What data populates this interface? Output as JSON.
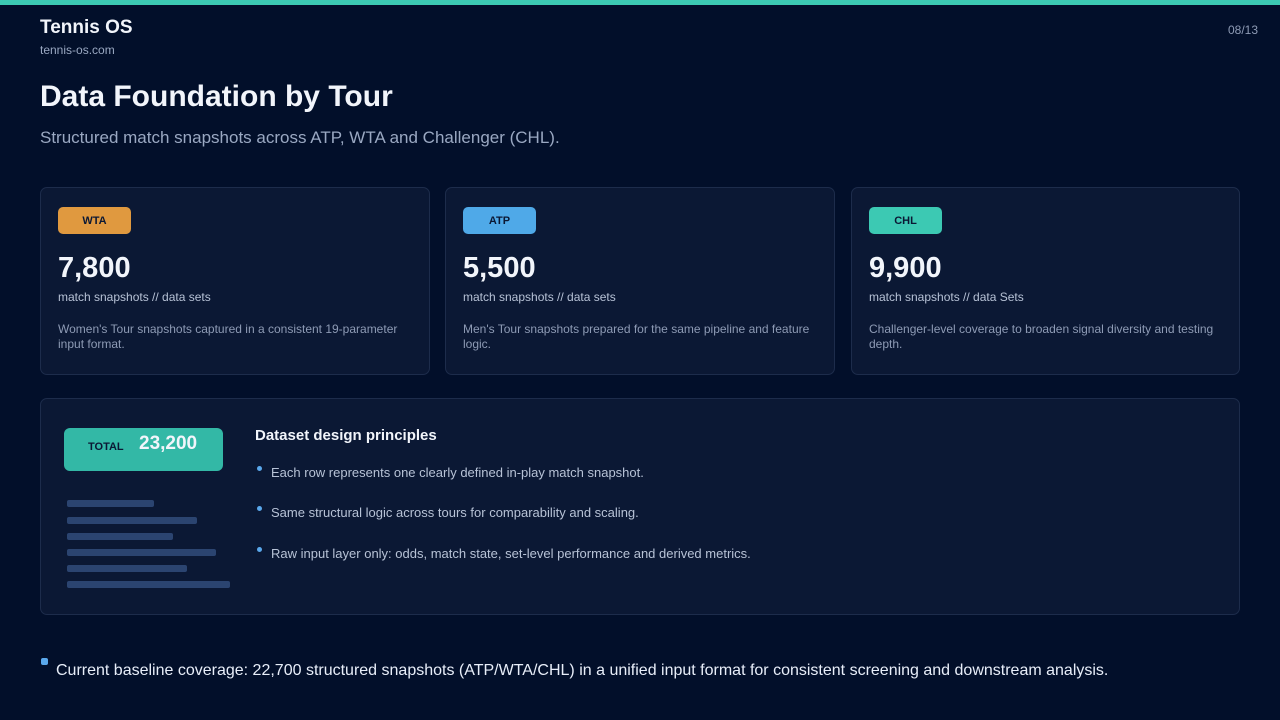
{
  "brand": {
    "name": "Tennis OS",
    "url": "tennis-os.com"
  },
  "page_number": "08/13",
  "title": "Data Foundation by Tour",
  "subtitle": "Structured match snapshots across ATP, WTA and Challenger (CHL).",
  "colors": {
    "accent": "#3cc9b3",
    "wta": "#e0993f",
    "atp": "#4fa9e8",
    "chl": "#3cc9b3",
    "background": "#020f2a",
    "card": "#0b1834"
  },
  "cards": [
    {
      "badge": "WTA",
      "value": "7,800",
      "unit": "match snapshots  // data sets",
      "description": "Women's Tour snapshots captured in a consistent 19-parameter input format."
    },
    {
      "badge": "ATP",
      "value": "5,500",
      "unit": "match snapshots  // data sets",
      "description": "Men's Tour snapshots prepared for the same pipeline and feature logic."
    },
    {
      "badge": "CHL",
      "value": "9,900",
      "unit": "match snapshots  // data Sets",
      "description": "Challenger-level coverage to broaden signal diversity and testing depth."
    }
  ],
  "total": {
    "label": "TOTAL",
    "value": "23,200"
  },
  "principles": {
    "title": "Dataset design principles",
    "items": [
      "Each row represents one clearly defined in-play match snapshot.",
      "Same structural logic across tours for comparability and scaling.",
      "Raw input layer only: odds, match state, set-level performance and derived metrics."
    ]
  },
  "footer": "Current baseline coverage: 22,700 structured snapshots (ATP/WTA/CHL) in a unified input format for consistent screening and downstream analysis."
}
